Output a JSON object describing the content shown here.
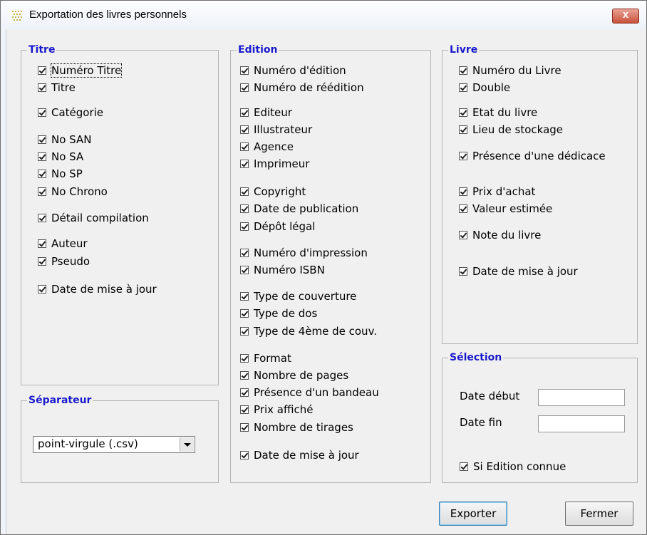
{
  "window": {
    "title": "Exportation des livres personnels",
    "close_label": "x"
  },
  "titre": {
    "legend": "Titre",
    "items": [
      "Numéro Titre",
      "Titre",
      "Catégorie",
      "No SAN",
      "No SA",
      "No SP",
      "No Chrono",
      "Détail compilation",
      "Auteur",
      "Pseudo",
      "Date de mise à jour"
    ]
  },
  "edition": {
    "legend": "Edition",
    "items": [
      "Numéro d'édition",
      "Numéro de réédition",
      "Editeur",
      "Illustrateur",
      "Agence",
      "Imprimeur",
      "Copyright",
      "Date de publication",
      "Dépôt légal",
      "Numéro d'impression",
      "Numéro ISBN",
      "Type de couverture",
      "Type de dos",
      "Type de 4ème de couv.",
      "Format",
      "Nombre de pages",
      "Présence d'un bandeau",
      "Prix affiché",
      "Nombre de tirages",
      "Date de mise à jour"
    ]
  },
  "livre": {
    "legend": "Livre",
    "items": [
      "Numéro du Livre",
      "Double",
      "Etat du livre",
      "Lieu de stockage",
      "Présence d'une dédicace",
      "Prix d'achat",
      "Valeur estimée",
      "Note du livre",
      "Date de mise à jour"
    ]
  },
  "separateur": {
    "legend": "Séparateur",
    "selected": "point-virgule (.csv)"
  },
  "selection": {
    "legend": "Sélection",
    "date_debut_label": "Date début",
    "date_fin_label": "Date fin",
    "date_debut_value": "",
    "date_fin_value": "",
    "si_edition_label": "Si Edition connue"
  },
  "buttons": {
    "export_label": "Exporter",
    "close_label": "Fermer"
  }
}
